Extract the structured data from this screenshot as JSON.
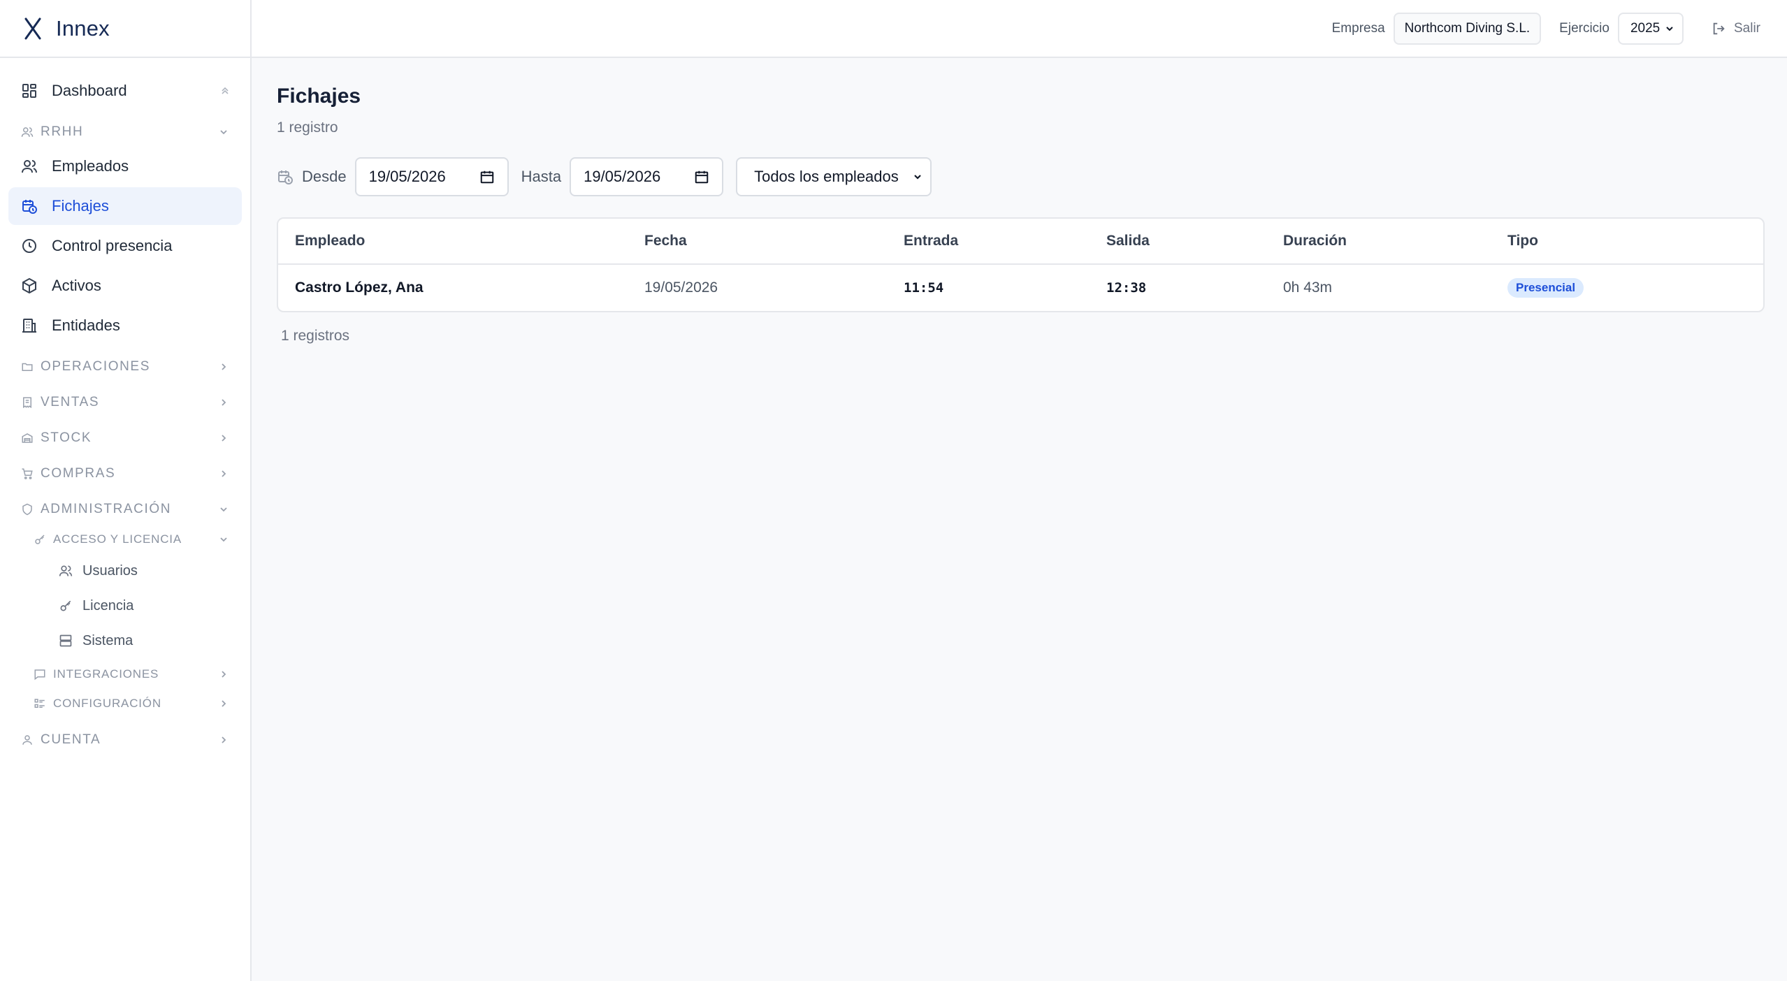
{
  "brand": {
    "name": "Innex"
  },
  "sidebar": {
    "dashboard": "Dashboard",
    "rrhh": {
      "label": "RRHH",
      "items": [
        "Empleados",
        "Fichajes",
        "Control presencia",
        "Activos",
        "Entidades"
      ]
    },
    "sections": [
      "OPERACIONES",
      "VENTAS",
      "STOCK",
      "COMPRAS"
    ],
    "admin": {
      "label": "ADMINISTRACIÓN",
      "acceso": {
        "label": "ACCESO Y LICENCIA",
        "items": [
          "Usuarios",
          "Licencia",
          "Sistema"
        ]
      },
      "integraciones": "INTEGRACIONES",
      "configuracion": "CONFIGURACIÓN"
    },
    "cuenta": "CUENTA"
  },
  "topbar": {
    "empresa_label": "Empresa",
    "empresa_value": "Northcom Diving S.L.",
    "ejercicio_label": "Ejercicio",
    "ejercicio_value": "2025",
    "logout_label": "Salir"
  },
  "page": {
    "title": "Fichajes",
    "subtitle": "1 registro",
    "filters": {
      "desde_label": "Desde",
      "desde_value": "19/05/2026",
      "hasta_label": "Hasta",
      "hasta_value": "19/05/2026",
      "employee_select": "Todos los empleados"
    },
    "table": {
      "headers": [
        "Empleado",
        "Fecha",
        "Entrada",
        "Salida",
        "Duración",
        "Tipo"
      ],
      "rows": [
        {
          "empleado": "Castro López, Ana",
          "fecha": "19/05/2026",
          "entrada": "11:54",
          "salida": "12:38",
          "duracion": "0h 43m",
          "tipo": "Presencial"
        }
      ]
    },
    "footer": "1 registros"
  },
  "colors": {
    "accent": "#1d4ed8",
    "active_bg": "#eef3fc",
    "badge_bg": "#dbeafe",
    "brand": "#162a55"
  }
}
